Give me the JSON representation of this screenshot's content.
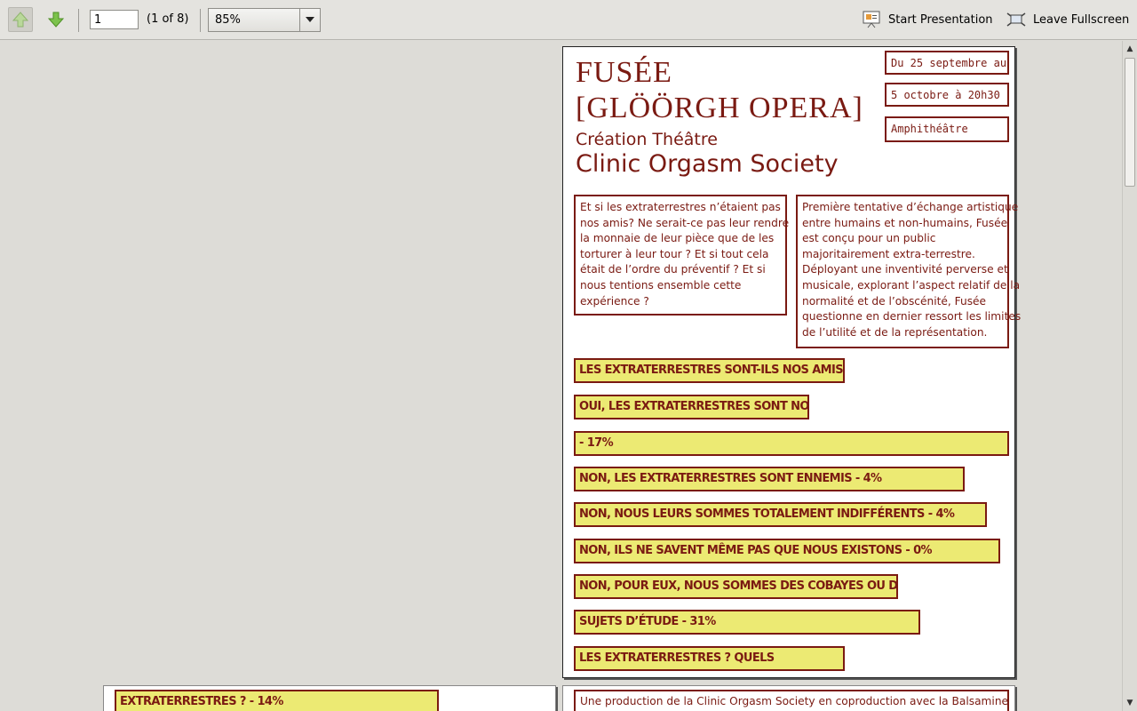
{
  "toolbar": {
    "page_input": "1",
    "page_count": "(1 of 8)",
    "zoom": "85%",
    "start_presentation": "Start Presentation",
    "leave_fullscreen": "Leave Fullscreen",
    "icons": [
      "previous-page-icon",
      "next-page-icon",
      "dropdown-arrow-icon",
      "presentation-icon",
      "leave-fullscreen-icon"
    ]
  },
  "document": {
    "title_line1": "FUSÉE",
    "title_line2": "[GLÖÖRGH OPERA]",
    "subtitle": "Création Théâtre",
    "company": "Clinic Orgasm Society",
    "dates": [
      "Du 25 septembre au",
      "5 octobre à 20h30",
      "Amphithéâtre"
    ],
    "intro_lines": [
      "Et si les extraterrestres n’étaient pas",
      "nos amis? Ne serait-ce pas leur rendre",
      "la monnaie de leur pièce que de les",
      "torturer à leur tour ? Et si tout cela",
      "était de l’ordre du préventif ? Et si",
      "nous tentions ensemble cette",
      "expérience ?"
    ],
    "description_lines": [
      "Première tentative d’échange artistique",
      "entre humains et non-humains, Fusée",
      "est conçu pour un public",
      "majoritairement extra-terrestre.",
      "Déployant une inventivité perverse et",
      "musicale, explorant l’aspect relatif de la",
      "normalité et de l’obscénité, Fusée",
      "questionne en dernier ressort les limites",
      "de l’utilité et de la représentation."
    ],
    "poll_bars": [
      "LES EXTRATERRESTRES SONT-ILS NOS AMIS ?",
      "OUI, LES EXTRATERRESTRES SONT NOS AMIS",
      "- 17%",
      "NON, LES EXTRATERRESTRES SONT ENNEMIS - 4%",
      "NON, NOUS LEURS SOMMES TOTALEMENT INDIFFÉRENTS - 4%",
      "NON, ILS NE SAVENT MÊME PAS QUE NOUS EXISTONS - 0%",
      "NON, POUR EUX, NOUS SOMMES DES COBAYES OU DES",
      "SUJETS D’ÉTUDE - 31%",
      "LES EXTRATERRESTRES ? QUELS"
    ],
    "next_left_bar": "EXTRATERRESTRES ? - 14%",
    "next_right_text": "Une production de la Clinic Orgasm Society en coproduction avec la Balsamine, le"
  }
}
